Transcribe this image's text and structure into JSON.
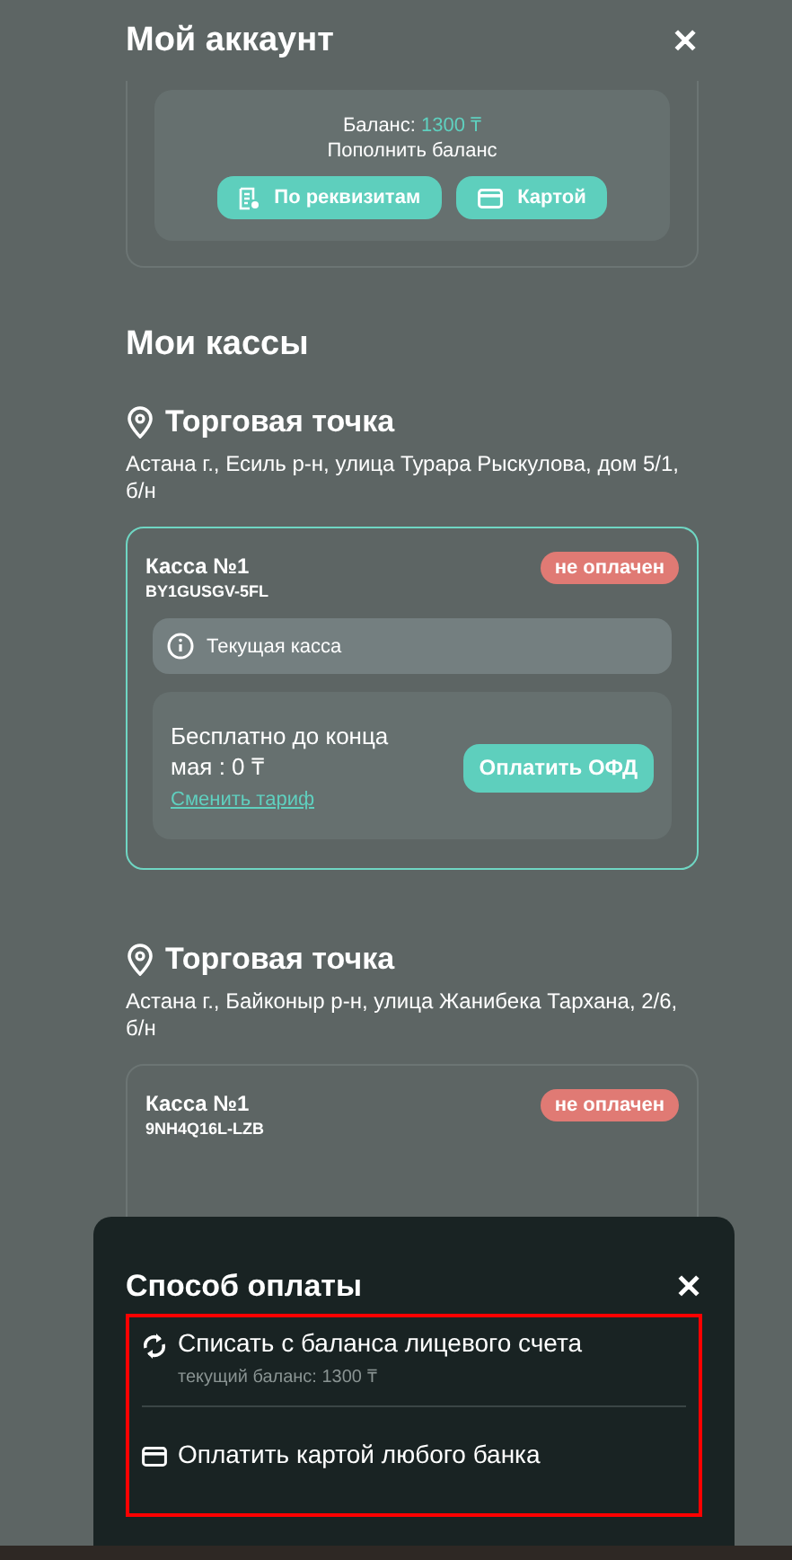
{
  "header": {
    "title": "Мой аккаунт",
    "close": "✕"
  },
  "account": {
    "balance_label": "Баланс:",
    "balance_value": "1300 ₸",
    "topup_label": "Пополнить баланс",
    "buttons": [
      {
        "kind": "invoice",
        "label": "По реквизитам"
      },
      {
        "kind": "card",
        "label": "Картой"
      }
    ]
  },
  "section_title": "Мои кассы",
  "points": [
    {
      "title": "Торговая точка",
      "address": "Астана г., Есиль р-н, улица Турара Рыскулова, дом 5/1, б/н",
      "registers": [
        {
          "name": "Касса №1",
          "serial": "BY1GUSGV-5FL",
          "status": "не оплачен",
          "selected": true,
          "current": "Текущая касса",
          "tariff": {
            "text": "Бесплатно до конца мая : 0 ₸",
            "link": "Сменить тариф",
            "button": "Оплатить ОФД"
          }
        }
      ]
    },
    {
      "title": "Торговая точка",
      "address": "Астана г., Байконыр р-н, улица Жанибека Тархана, 2/6, б/н",
      "registers": [
        {
          "name": "Касса №1",
          "serial": "9NH4Q16L-LZB",
          "status": "не оплачен",
          "selected": false
        }
      ]
    }
  ],
  "sheet": {
    "title": "Способ оплаты",
    "close": "✕",
    "highlighted": true,
    "options": [
      {
        "kind": "balance",
        "title": "Списать с баланса лицевого счета",
        "subtitle": "текущий баланс: 1300 ₸"
      },
      {
        "kind": "card",
        "title": "Оплатить картой любого банка"
      }
    ]
  }
}
